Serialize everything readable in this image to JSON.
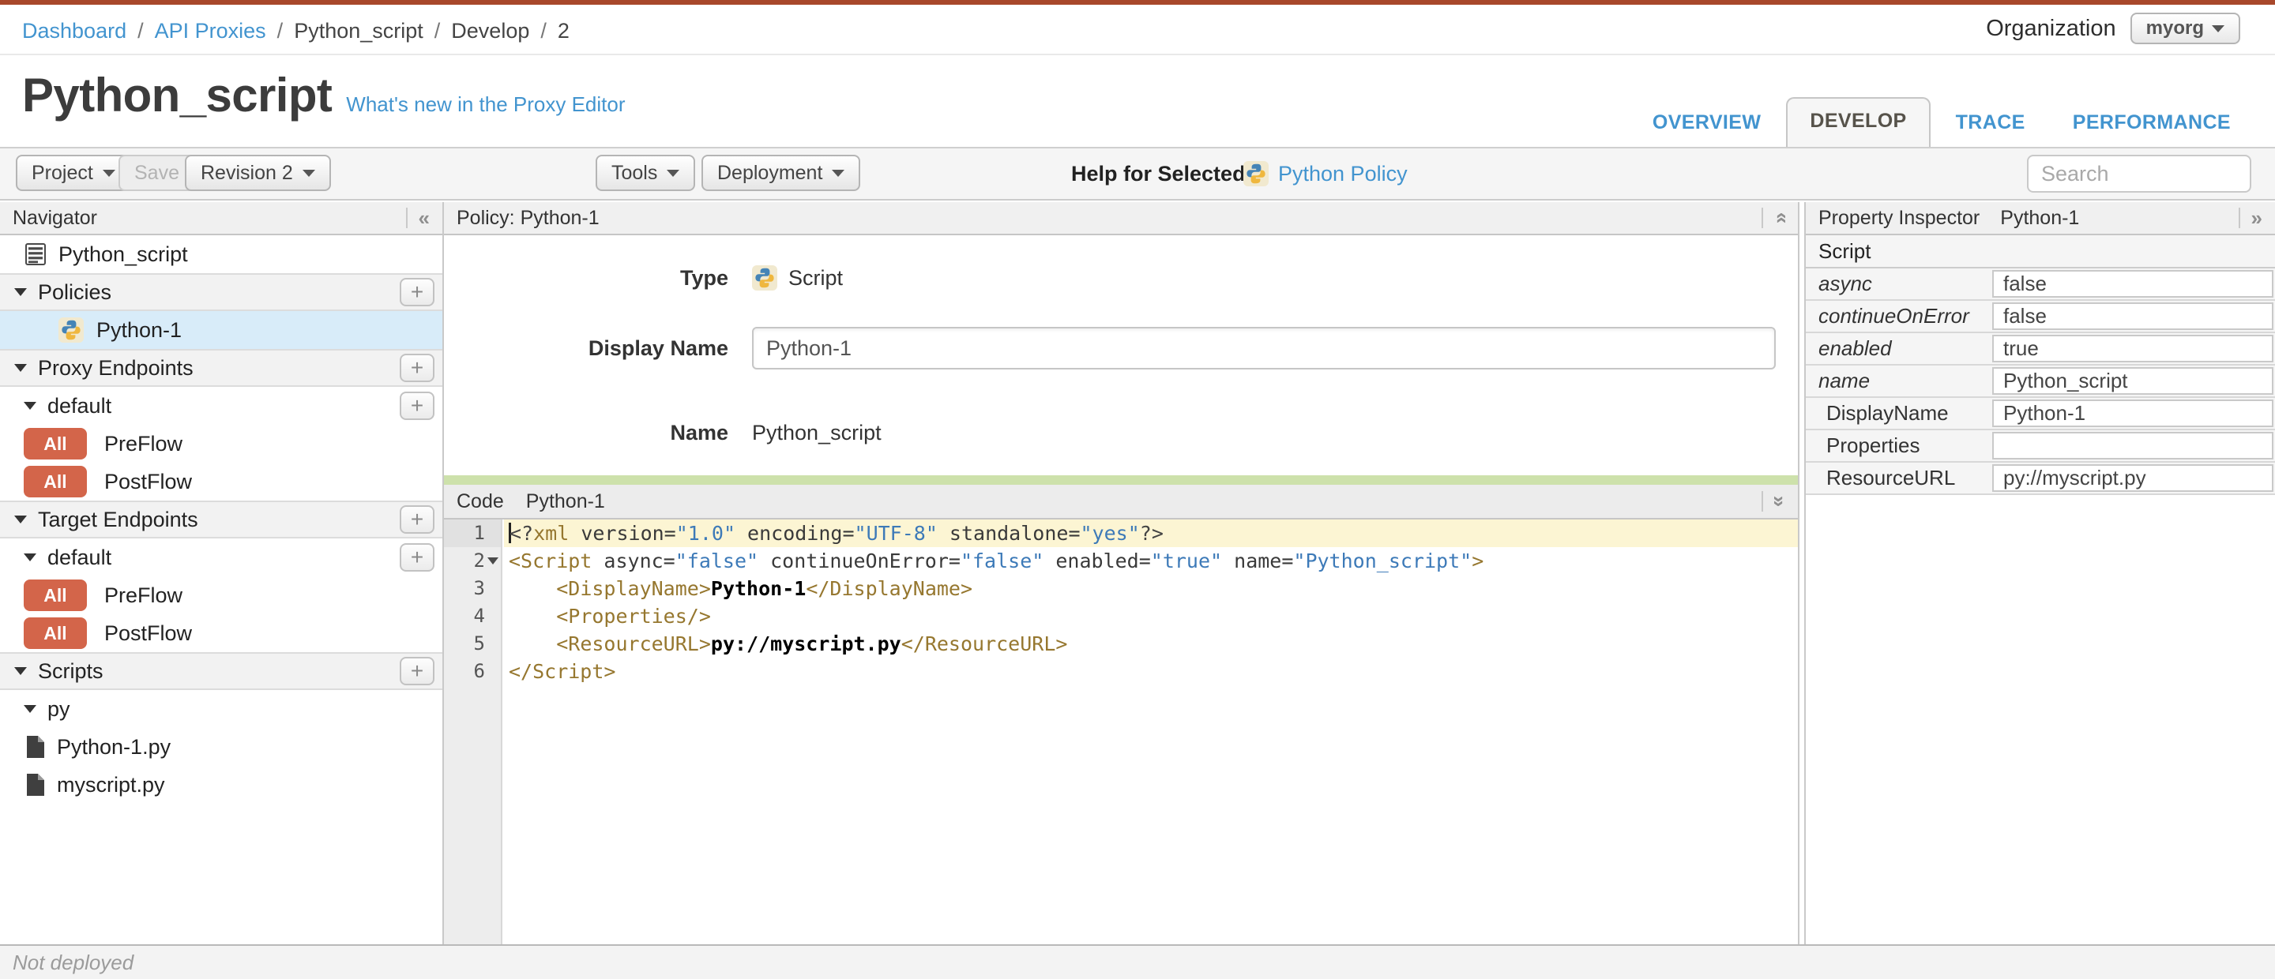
{
  "breadcrumb": {
    "separator": "/",
    "items": [
      {
        "label": "Dashboard",
        "type": "link"
      },
      {
        "label": "API Proxies",
        "type": "link"
      },
      {
        "label": "Python_script",
        "type": "text"
      },
      {
        "label": "Develop",
        "type": "text"
      },
      {
        "label": "2",
        "type": "text"
      }
    ]
  },
  "organization": {
    "label": "Organization",
    "value": "myorg"
  },
  "header": {
    "title": "Python_script",
    "whats_new_link": "What's new in the Proxy Editor"
  },
  "tabs": [
    {
      "label": "OVERVIEW",
      "active": false
    },
    {
      "label": "DEVELOP",
      "active": true
    },
    {
      "label": "TRACE",
      "active": false
    },
    {
      "label": "PERFORMANCE",
      "active": false
    }
  ],
  "toolbar": {
    "project_label": "Project",
    "save_label": "Save",
    "revision_label": "Revision 2",
    "tools_label": "Tools",
    "deployment_label": "Deployment",
    "help_for_selected_label": "Help for Selected",
    "help_policy_link": "Python Policy",
    "search_placeholder": "Search"
  },
  "navigator": {
    "title": "Navigator",
    "collapse_icon": "chevron-double-left",
    "items": [
      {
        "type": "item",
        "icon": "spec-icon",
        "label": "Python_script"
      },
      {
        "type": "section",
        "label": "Policies",
        "add": true
      },
      {
        "type": "item",
        "icon": "python-icon",
        "label": "Python-1",
        "policy": true,
        "selected": true
      },
      {
        "type": "section",
        "label": "Proxy Endpoints",
        "add": true
      },
      {
        "type": "subsection",
        "label": "default",
        "add": true
      },
      {
        "type": "flow",
        "badge": "All",
        "label": "PreFlow"
      },
      {
        "type": "flow",
        "badge": "All",
        "label": "PostFlow"
      },
      {
        "type": "section",
        "label": "Target Endpoints",
        "add": true
      },
      {
        "type": "subsection",
        "label": "default",
        "add": true
      },
      {
        "type": "flow",
        "badge": "All",
        "label": "PreFlow"
      },
      {
        "type": "flow",
        "badge": "All",
        "label": "PostFlow"
      },
      {
        "type": "section",
        "label": "Scripts",
        "add": true
      },
      {
        "type": "subsection",
        "label": "py"
      },
      {
        "type": "file",
        "icon": "file-icon",
        "label": "Python-1.py"
      },
      {
        "type": "file",
        "icon": "file-icon",
        "label": "myscript.py"
      }
    ]
  },
  "policy": {
    "panel_title": "Policy: Python-1",
    "type_label": "Type",
    "type_value": "Script",
    "display_name_label": "Display Name",
    "display_name_value": "Python-1",
    "name_label": "Name",
    "name_value": "Python_script"
  },
  "code": {
    "panel_title": "Code",
    "policy_name": "Python-1",
    "active_line": 1,
    "folds": [
      2
    ],
    "lines": [
      [
        {
          "t": "<?",
          "c": "br"
        },
        {
          "t": "xml",
          "c": "tag"
        },
        {
          "t": " version=",
          "c": "attr"
        },
        {
          "t": "\"1.0\"",
          "c": "str"
        },
        {
          "t": " encoding=",
          "c": "attr"
        },
        {
          "t": "\"UTF-8\"",
          "c": "str"
        },
        {
          "t": " standalone=",
          "c": "attr"
        },
        {
          "t": "\"yes\"",
          "c": "str"
        },
        {
          "t": "?>",
          "c": "br"
        }
      ],
      [
        {
          "t": "<Script",
          "c": "tag"
        },
        {
          "t": " async=",
          "c": "attr"
        },
        {
          "t": "\"false\"",
          "c": "str"
        },
        {
          "t": " continueOnError=",
          "c": "attr"
        },
        {
          "t": "\"false\"",
          "c": "str"
        },
        {
          "t": " enabled=",
          "c": "attr"
        },
        {
          "t": "\"true\"",
          "c": "str"
        },
        {
          "t": " name=",
          "c": "attr"
        },
        {
          "t": "\"Python_script\"",
          "c": "str"
        },
        {
          "t": ">",
          "c": "tag"
        }
      ],
      [
        {
          "t": "    ",
          "c": "txt"
        },
        {
          "t": "<DisplayName>",
          "c": "tag"
        },
        {
          "t": "Python-1",
          "c": "txt"
        },
        {
          "t": "</DisplayName>",
          "c": "tag"
        }
      ],
      [
        {
          "t": "    ",
          "c": "txt"
        },
        {
          "t": "<Properties/>",
          "c": "tag"
        }
      ],
      [
        {
          "t": "    ",
          "c": "txt"
        },
        {
          "t": "<ResourceURL>",
          "c": "tag"
        },
        {
          "t": "py://myscript.py",
          "c": "txt"
        },
        {
          "t": "</ResourceURL>",
          "c": "tag"
        }
      ],
      [
        {
          "t": "</Script>",
          "c": "tag"
        }
      ]
    ]
  },
  "property_inspector": {
    "title": "Property Inspector",
    "policy_name": "Python-1",
    "section_header": "Script",
    "rows": [
      {
        "label": "async",
        "value": "false",
        "italic": true
      },
      {
        "label": "continueOnError",
        "value": "false",
        "italic": true
      },
      {
        "label": "enabled",
        "value": "true",
        "italic": true
      },
      {
        "label": "name",
        "value": "Python_script",
        "italic": true
      },
      {
        "label": "DisplayName",
        "value": "Python-1",
        "italic": false
      },
      {
        "label": "Properties",
        "value": "",
        "italic": false
      },
      {
        "label": "ResourceURL",
        "value": "py://myscript.py",
        "italic": false
      }
    ]
  },
  "status_bar": {
    "text": "Not deployed"
  },
  "colors": {
    "top_bar": "#a8482b",
    "link_blue": "#4294cf",
    "flow_badge": "#d3654a",
    "selected_row": "#d8ecf9",
    "active_line": "#fcf5d3",
    "code_splitter_green": "#cde1ab"
  }
}
